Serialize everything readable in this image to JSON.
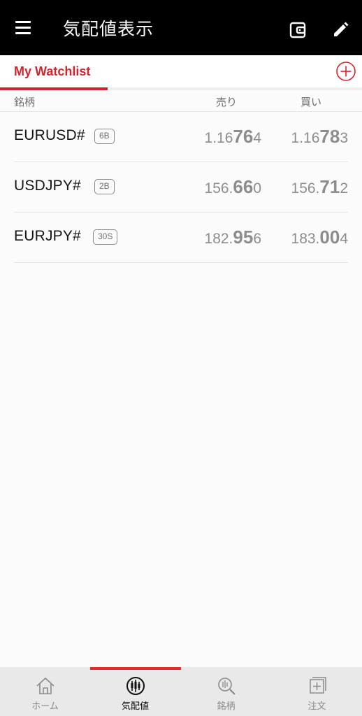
{
  "header": {
    "title": "気配値表示",
    "icons": [
      "menu-icon",
      "wallet-icon",
      "edit-icon"
    ]
  },
  "tabs": {
    "active_label": "My Watchlist",
    "add_icon": "plus-circle-icon"
  },
  "columns": {
    "symbol": "銘柄",
    "bid": "売り",
    "ask": "買い"
  },
  "rows": [
    {
      "symbol": "EURUSD#",
      "badge": "6B",
      "bid": {
        "pre": "1.16",
        "big": "76",
        "post": "4"
      },
      "ask": {
        "pre": "1.16",
        "big": "78",
        "post": "3"
      }
    },
    {
      "symbol": "USDJPY#",
      "badge": "2B",
      "bid": {
        "pre": "156.",
        "big": "66",
        "post": "0"
      },
      "ask": {
        "pre": "156.",
        "big": "71",
        "post": "2"
      }
    },
    {
      "symbol": "EURJPY#",
      "badge": "30S",
      "bid": {
        "pre": "182.",
        "big": "95",
        "post": "6"
      },
      "ask": {
        "pre": "183.",
        "big": "00",
        "post": "4"
      }
    }
  ],
  "bottom_nav": [
    {
      "label": "ホーム",
      "icon": "home-icon",
      "active": false
    },
    {
      "label": "気配値",
      "icon": "quotes-icon",
      "active": true
    },
    {
      "label": "銘柄",
      "icon": "chart-search-icon",
      "active": false
    },
    {
      "label": "注文",
      "icon": "order-icon",
      "active": false
    }
  ],
  "colors": {
    "accent": "#d6222a",
    "header_bg": "#000000",
    "price_text": "#8d8d8d",
    "nav_indicator": "#e32b2b"
  }
}
